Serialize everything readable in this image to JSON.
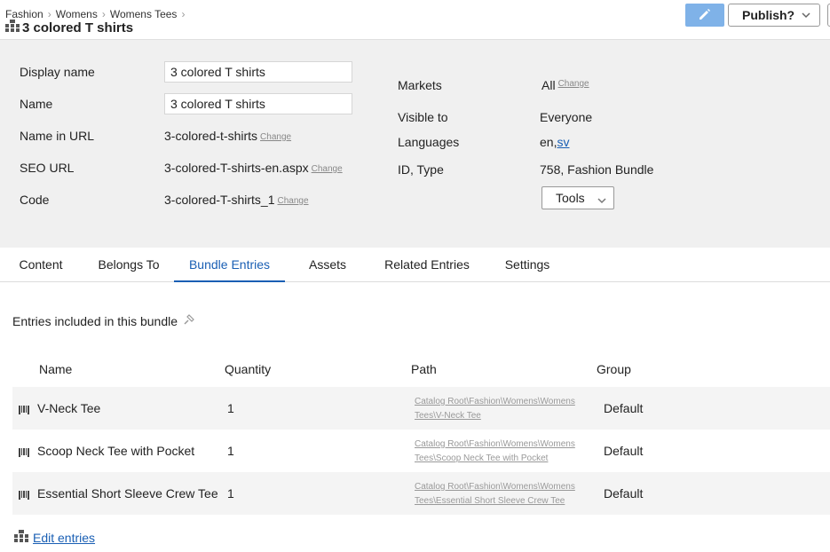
{
  "header": {
    "breadcrumbs": [
      "Fashion",
      "Womens",
      "Womens Tees"
    ],
    "title": "3 colored T shirts",
    "publish_label": "Publish?",
    "edit_color": "#7fb2e8"
  },
  "properties": {
    "display_name_label": "Display name",
    "display_name_value": "3 colored T shirts",
    "name_label": "Name",
    "name_value": "3 colored T shirts",
    "name_in_url_label": "Name in URL",
    "name_in_url_value": "3-colored-t-shirts",
    "seo_url_label": "SEO URL",
    "seo_url_value": "3-colored-T-shirts-en.aspx",
    "code_label": "Code",
    "code_value": "3-colored-T-shirts_1",
    "change_label": "Change",
    "markets_label": "Markets",
    "markets_value": "All",
    "visible_to_label": "Visible to",
    "visible_to_value": "Everyone",
    "languages_label": "Languages",
    "languages_en": "en,",
    "languages_sv": "sv",
    "id_type_label": "ID, Type",
    "id_type_value": "758, Fashion Bundle",
    "tools_label": "Tools"
  },
  "tabs": [
    {
      "label": "Content",
      "active": false
    },
    {
      "label": "Belongs To",
      "active": false
    },
    {
      "label": "Bundle Entries",
      "active": true
    },
    {
      "label": "Assets",
      "active": false
    },
    {
      "label": "Related Entries",
      "active": false
    },
    {
      "label": "Settings",
      "active": false
    }
  ],
  "bundle": {
    "section_label": "Entries included in this bundle",
    "columns": [
      "Name",
      "Quantity",
      "Path",
      "Group"
    ],
    "rows": [
      {
        "name": "V-Neck Tee",
        "quantity": "1",
        "path_line1": "Catalog Root\\Fashion\\Womens\\Womens",
        "path_line2": "Tees\\V-Neck Tee",
        "group": "Default"
      },
      {
        "name": "Scoop Neck Tee with Pocket",
        "quantity": "1",
        "path_line1": "Catalog Root\\Fashion\\Womens\\Womens",
        "path_line2": "Tees\\Scoop Neck Tee with Pocket",
        "group": "Default"
      },
      {
        "name": "Essential Short Sleeve Crew Tee",
        "quantity": "1",
        "path_line1": "Catalog Root\\Fashion\\Womens\\Womens",
        "path_line2": "Tees\\Essential Short Sleeve Crew Tee",
        "group": "Default"
      }
    ],
    "edit_entries_label": "Edit entries"
  },
  "colors": {
    "accent": "#1a5fb4",
    "panel_bg": "#f0f0f0",
    "row_shade": "#f4f4f4"
  }
}
